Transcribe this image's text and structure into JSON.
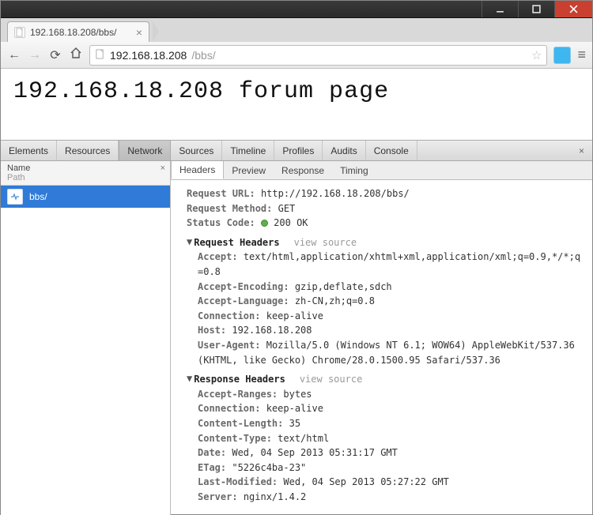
{
  "window": {
    "tab_title": "192.168.18.208/bbs/"
  },
  "omnibox": {
    "host": "192.168.18.208",
    "path": "/bbs/"
  },
  "page": {
    "heading": "192.168.18.208 forum page"
  },
  "devtools": {
    "tabs": [
      "Elements",
      "Resources",
      "Network",
      "Sources",
      "Timeline",
      "Profiles",
      "Audits",
      "Console"
    ],
    "active_tab": "Network",
    "left": {
      "col_name": "Name",
      "col_path": "Path",
      "rows": [
        {
          "name": "bbs/"
        }
      ]
    },
    "subtabs": [
      "Headers",
      "Preview",
      "Response",
      "Timing"
    ],
    "active_subtab": "Headers",
    "headers": {
      "general": {
        "request_url_k": "Request URL:",
        "request_url_v": "http://192.168.18.208/bbs/",
        "request_method_k": "Request Method:",
        "request_method_v": "GET",
        "status_code_k": "Status Code:",
        "status_code_v": "200 OK"
      },
      "req_title": "Request Headers",
      "view_source": "view source",
      "request": {
        "accept_k": "Accept:",
        "accept_v": "text/html,application/xhtml+xml,application/xml;q=0.9,*/*;q=0.8",
        "accept_enc_k": "Accept-Encoding:",
        "accept_enc_v": "gzip,deflate,sdch",
        "accept_lang_k": "Accept-Language:",
        "accept_lang_v": "zh-CN,zh;q=0.8",
        "connection_k": "Connection:",
        "connection_v": "keep-alive",
        "host_k": "Host:",
        "host_v": "192.168.18.208",
        "ua_k": "User-Agent:",
        "ua_v": "Mozilla/5.0 (Windows NT 6.1; WOW64) AppleWebKit/537.36 (KHTML, like Gecko) Chrome/28.0.1500.95 Safari/537.36"
      },
      "resp_title": "Response Headers",
      "response": {
        "accept_ranges_k": "Accept-Ranges:",
        "accept_ranges_v": "bytes",
        "connection_k": "Connection:",
        "connection_v": "keep-alive",
        "content_length_k": "Content-Length:",
        "content_length_v": "35",
        "content_type_k": "Content-Type:",
        "content_type_v": "text/html",
        "date_k": "Date:",
        "date_v": "Wed, 04 Sep 2013 05:31:17 GMT",
        "etag_k": "ETag:",
        "etag_v": "\"5226c4ba-23\"",
        "last_mod_k": "Last-Modified:",
        "last_mod_v": "Wed, 04 Sep 2013 05:27:22 GMT",
        "server_k": "Server:",
        "server_v": "nginx/1.4.2"
      }
    }
  }
}
